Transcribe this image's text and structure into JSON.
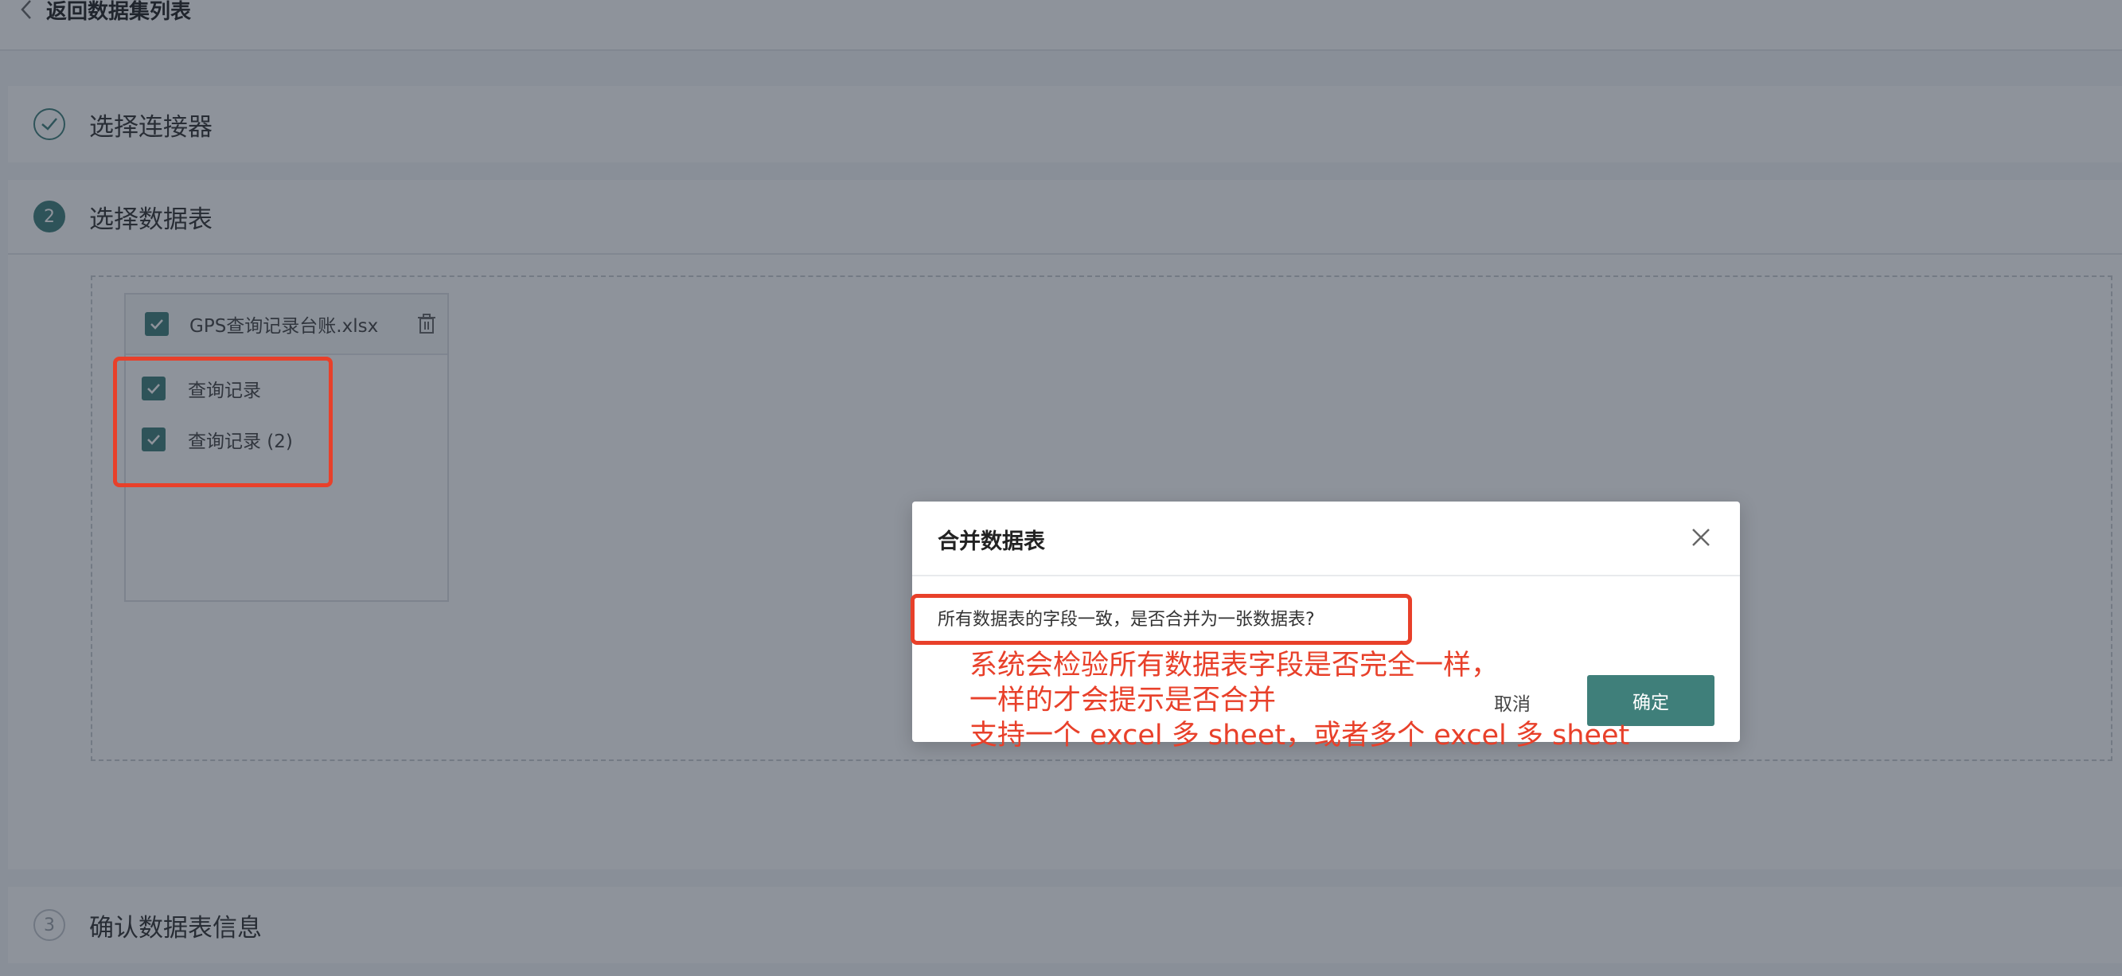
{
  "header": {
    "back_label": "返回数据集列表"
  },
  "steps": [
    {
      "number": "✓",
      "title": "选择连接器",
      "state": "done"
    },
    {
      "number": "2",
      "title": "选择数据表",
      "state": "active"
    },
    {
      "number": "3",
      "title": "确认数据表信息",
      "state": "todo"
    }
  ],
  "file": {
    "name": "GPS查询记录台账.xlsx",
    "sheets": [
      {
        "label": "查询记录"
      },
      {
        "label": "查询记录 (2)"
      }
    ]
  },
  "modal": {
    "title": "合并数据表",
    "message": "所有数据表的字段一致，是否合并为一张数据表?",
    "cancel_label": "取消",
    "ok_label": "确定"
  },
  "annotation": {
    "lines": [
      "系统会检验所有数据表字段是否完全一样，",
      "一样的才会提示是否合并",
      "支持一个 excel 多 sheet，或者多个 excel 多 sheet"
    ]
  },
  "colors": {
    "accent": "#3f7f7a",
    "annotation_red": "#e8402a"
  }
}
